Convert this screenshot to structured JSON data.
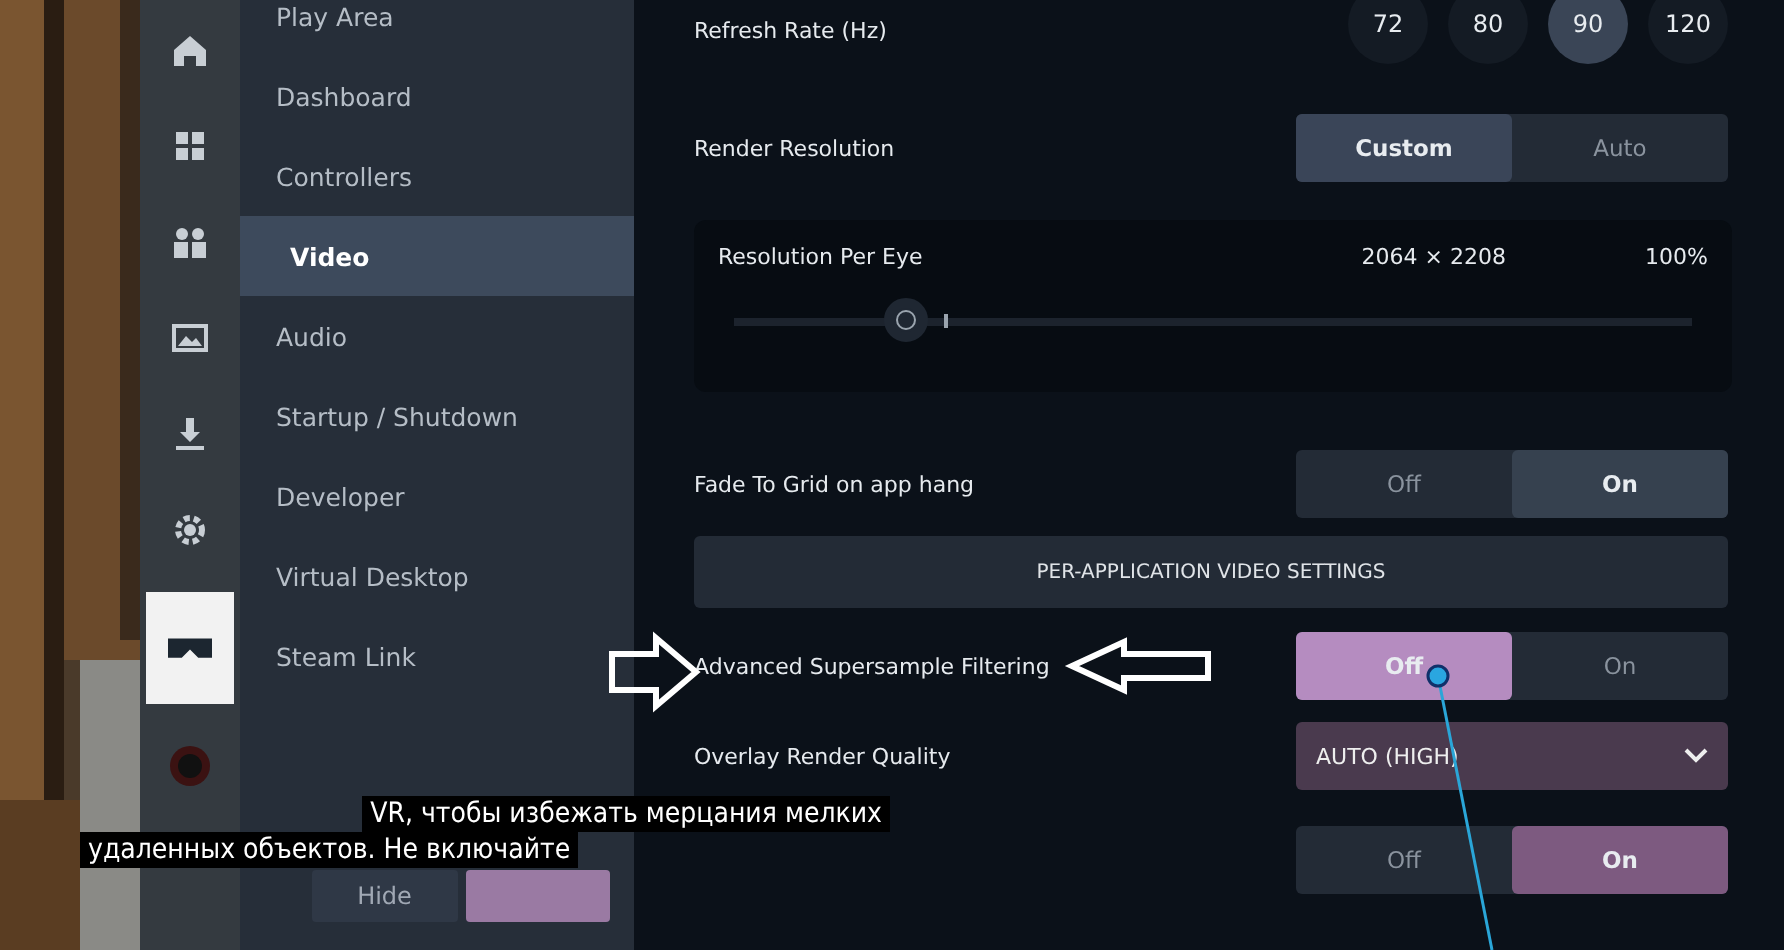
{
  "rail": {
    "items": [
      {
        "selected": false
      },
      {
        "selected": false
      },
      {
        "selected": false
      },
      {
        "selected": false
      },
      {
        "selected": false
      },
      {
        "selected": false
      },
      {
        "selected": true
      },
      {
        "selected": false
      }
    ]
  },
  "nav": {
    "items": [
      {
        "label": "Play Area",
        "selected": false
      },
      {
        "label": "Dashboard",
        "selected": false
      },
      {
        "label": "Controllers",
        "selected": false
      },
      {
        "label": "Video",
        "selected": true
      },
      {
        "label": "Audio",
        "selected": false
      },
      {
        "label": "Startup / Shutdown",
        "selected": false
      },
      {
        "label": "Developer",
        "selected": false
      },
      {
        "label": "Virtual Desktop",
        "selected": false
      },
      {
        "label": "Steam Link",
        "selected": false
      }
    ],
    "buttons": [
      {
        "label": "Hide",
        "kind": "plain"
      },
      {
        "kind": "accent"
      }
    ]
  },
  "rows": [
    {
      "kind": "rate",
      "label": "Refresh Rate (Hz)",
      "options": [
        {
          "label": "72",
          "selected": false
        },
        {
          "label": "80",
          "selected": false
        },
        {
          "label": "90",
          "selected": true
        },
        {
          "label": "120",
          "selected": false
        }
      ]
    },
    {
      "kind": "toggle",
      "label": "Render Resolution",
      "color": "#3a4558",
      "options": [
        {
          "label": "Custom",
          "selected": true
        },
        {
          "label": "Auto",
          "selected": false
        }
      ]
    },
    {
      "kind": "slider",
      "label": "Resolution Per Eye",
      "resolution": "2064 × 2208",
      "percent": "100%",
      "level": 0.18
    },
    {
      "kind": "toggle",
      "label": "Fade To Grid on app hang",
      "color": "#36414f",
      "options": [
        {
          "label": "Off",
          "selected": false
        },
        {
          "label": "On",
          "selected": true
        }
      ]
    },
    {
      "kind": "bar",
      "label": "PER-APPLICATION VIDEO SETTINGS"
    },
    {
      "kind": "toggle",
      "label": "Advanced Supersample Filtering",
      "color": "#b58cc0",
      "options": [
        {
          "label": "Off",
          "selected": true
        },
        {
          "label": "On",
          "selected": false
        }
      ]
    },
    {
      "kind": "dropdown",
      "label": "Overlay Render Quality",
      "value": "AUTO (HIGH)"
    },
    {
      "kind": "toggle",
      "color": "#7d5a80",
      "options": [
        {
          "label": "Off",
          "selected": false
        },
        {
          "label": "On",
          "selected": true
        }
      ]
    }
  ],
  "subtitles": [
    "VR, чтобы избежать мерцания мелких",
    "удаленных объектов.  Не включайте"
  ]
}
